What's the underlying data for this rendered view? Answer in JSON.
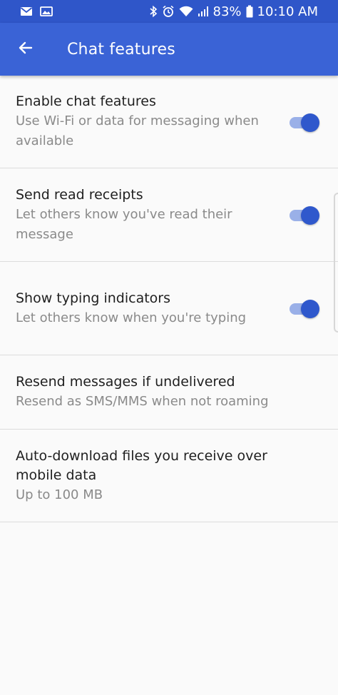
{
  "status_bar": {
    "battery": "83%",
    "time": "10:10 AM",
    "icons": [
      "mail-icon",
      "image-icon",
      "bluetooth-icon",
      "alarm-icon",
      "wifi-icon",
      "signal-icon",
      "battery-icon"
    ]
  },
  "header": {
    "title": "Chat features",
    "back_icon": "arrow-left-icon"
  },
  "settings": [
    {
      "title": "Enable chat features",
      "subtitle": "Use Wi-Fi or data for messaging when available",
      "toggle": true
    },
    {
      "title": "Send read receipts",
      "subtitle": "Let others know you've read their message",
      "toggle": true
    },
    {
      "title": "Show typing indicators",
      "subtitle": "Let others know when you're typing",
      "toggle": true
    },
    {
      "title": "Resend messages if undelivered",
      "subtitle": "Resend as SMS/MMS when not roaming"
    },
    {
      "title": "Auto-download files you receive over mobile data",
      "subtitle": "Up to 100 MB"
    }
  ],
  "colors": {
    "status_bar": "#2f56c9",
    "app_bar": "#3a63d6",
    "switch_thumb": "#2f58cc",
    "switch_track": "#9ab0e8"
  }
}
